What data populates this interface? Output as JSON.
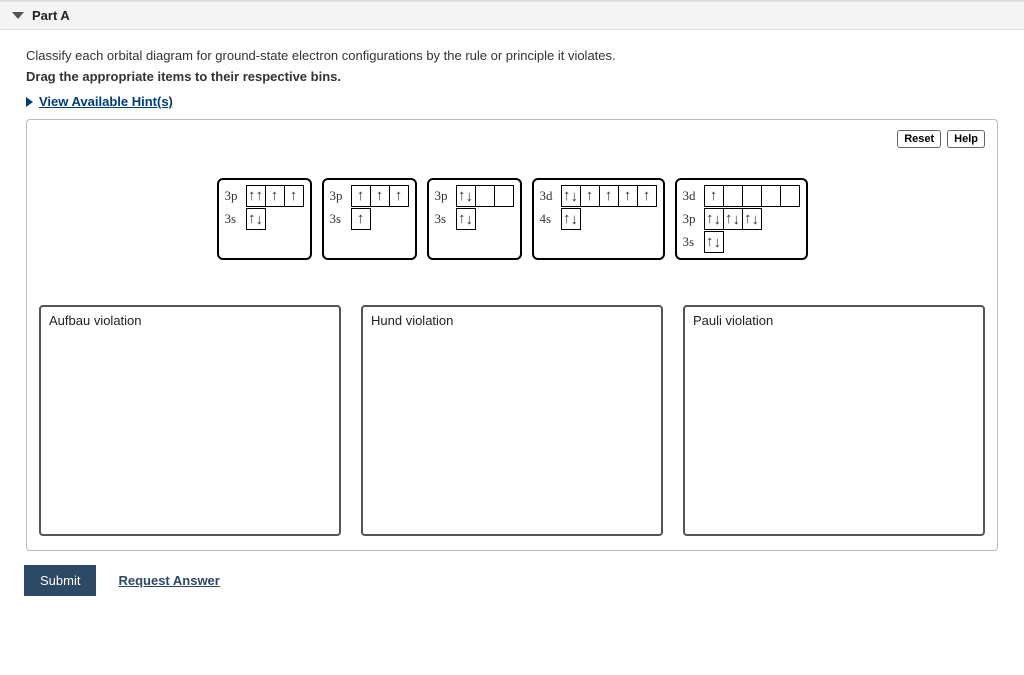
{
  "part": {
    "title": "Part A"
  },
  "prompt": "Classify each orbital diagram for ground-state electron configurations by the rule or principle it violates.",
  "instruction": "Drag the appropriate items to their respective bins.",
  "hints_label": "View Available Hint(s)",
  "buttons": {
    "reset": "Reset",
    "help": "Help",
    "submit": "Submit",
    "request": "Request Answer"
  },
  "bins": {
    "a": "Aufbau violation",
    "b": "Hund violation",
    "c": "Pauli violation"
  },
  "cards": [
    {
      "rows": [
        {
          "label": "3p",
          "boxes": [
            "uu",
            "u",
            "u"
          ]
        },
        {
          "label": "3s",
          "boxes": [
            "ud"
          ]
        }
      ]
    },
    {
      "rows": [
        {
          "label": "3p",
          "boxes": [
            "u",
            "u",
            "u"
          ]
        },
        {
          "label": "3s",
          "boxes": [
            "u"
          ]
        }
      ]
    },
    {
      "rows": [
        {
          "label": "3p",
          "boxes": [
            "ud",
            "",
            ""
          ]
        },
        {
          "label": "3s",
          "boxes": [
            "ud"
          ]
        }
      ]
    },
    {
      "rows": [
        {
          "label": "3d",
          "boxes": [
            "ud",
            "u",
            "u",
            "u",
            "u"
          ]
        },
        {
          "label": "4s",
          "boxes": [
            "ud"
          ]
        }
      ]
    },
    {
      "rows": [
        {
          "label": "3d",
          "boxes": [
            "u",
            "",
            "",
            "",
            ""
          ]
        },
        {
          "label": "3p",
          "boxes": [
            "ud",
            "ud",
            "ud"
          ]
        },
        {
          "label": "3s",
          "boxes": [
            "ud"
          ]
        }
      ]
    }
  ]
}
